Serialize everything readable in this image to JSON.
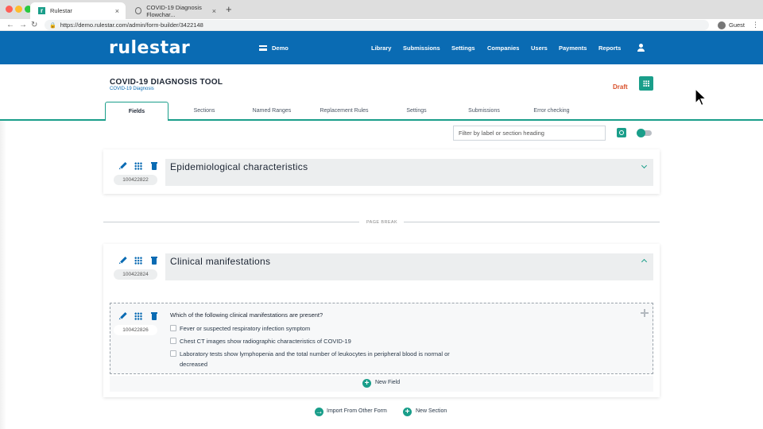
{
  "browser": {
    "tabs": [
      {
        "title": "Rulestar"
      },
      {
        "title": "COVID-19 Diagnosis Flowchar..."
      }
    ],
    "new_tab": "+",
    "url": "https://demo.rulestar.com/admin/form-builder/3422148",
    "profile": "Guest",
    "close_glyph": "×"
  },
  "header": {
    "logo": "rulestar",
    "workspace": "Demo",
    "nav": [
      "Library",
      "Submissions",
      "Settings",
      "Companies",
      "Users",
      "Payments",
      "Reports"
    ]
  },
  "form": {
    "title": "COVID-19 DIAGNOSIS TOOL",
    "subtitle": "COVID-19 Diagnosis",
    "status": "Draft"
  },
  "tabs": [
    "Fields",
    "Sections",
    "Named Ranges",
    "Replacement Rules",
    "Settings",
    "Submissions",
    "Error checking"
  ],
  "filter": {
    "placeholder": "Filter by label or section heading"
  },
  "sections": [
    {
      "id": "100422822",
      "title": "Epidemiological characteristics",
      "expanded": false
    },
    {
      "id": "100422824",
      "title": "Clinical manifestations",
      "expanded": true
    }
  ],
  "page_break": "PAGE BREAK",
  "field": {
    "id": "100422826",
    "question": "Which of the following clinical manifestations are present?",
    "options": [
      {
        "label": "Fever or suspected respiratory infection symptom",
        "checked": false
      },
      {
        "label": "Chest CT images show radiographic characteristics of COVID-19",
        "checked": false
      },
      {
        "label": "Laboratory tests show lymphopenia and the total number of leukocytes in peripheral blood is normal or decreased",
        "checked": false
      }
    ]
  },
  "actions": {
    "new_field": "New Field",
    "import": "Import From Other Form",
    "new_section": "New Section"
  },
  "colors": {
    "primary": "#0a6bb3",
    "accent": "#1a9e8a",
    "draft": "#d9502b"
  }
}
